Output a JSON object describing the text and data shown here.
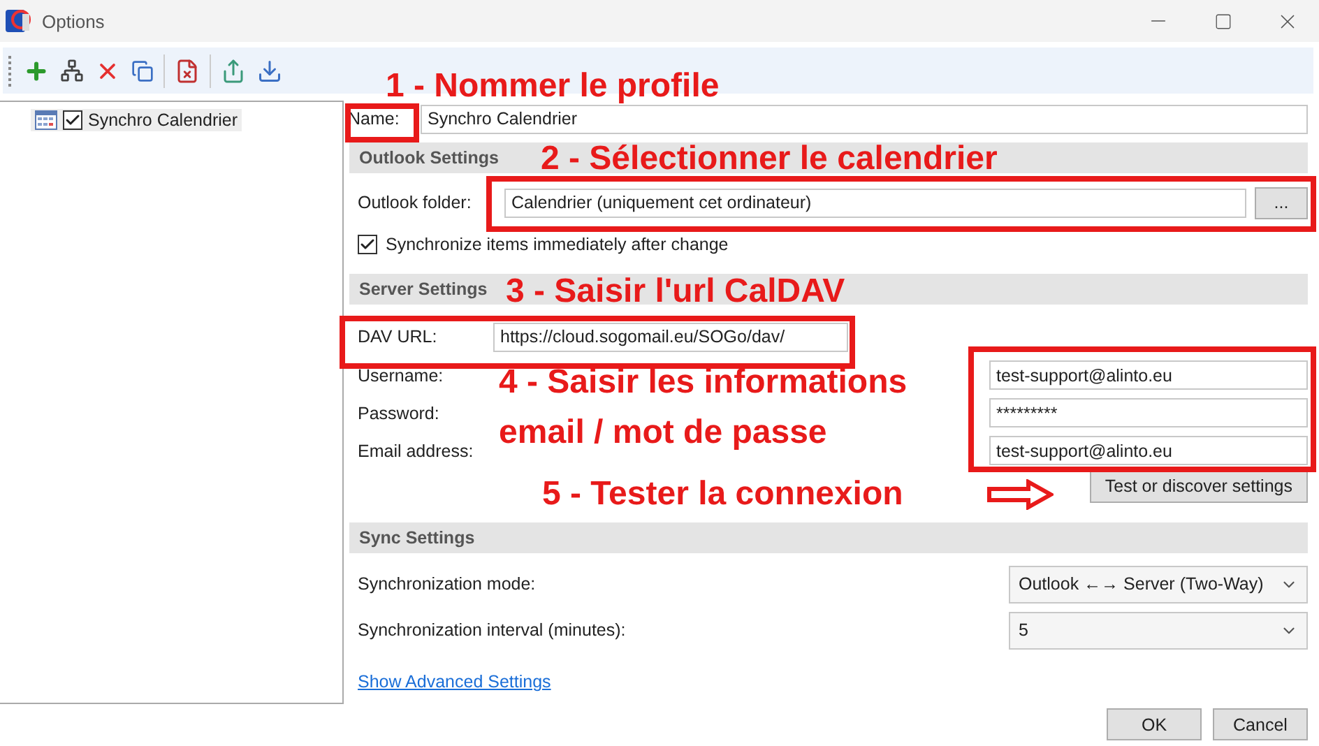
{
  "window": {
    "title": "Options"
  },
  "tree": {
    "items": [
      {
        "label": "Synchro Calendrier",
        "checked": true,
        "selected": true
      }
    ]
  },
  "profile": {
    "name_label": "Name:",
    "name_value": "Synchro Calendrier"
  },
  "outlook_settings": {
    "header": "Outlook Settings",
    "folder_label": "Outlook folder:",
    "folder_value": "Calendrier (uniquement cet ordinateur)",
    "browse_button": "...",
    "sync_immediately": {
      "label": "Synchronize items immediately after change",
      "checked": true
    }
  },
  "server_settings": {
    "header": "Server Settings",
    "dav_url_label": "DAV URL:",
    "dav_url": "https://cloud.sogomail.eu/SOGo/dav/",
    "fields": [
      {
        "label": "Username:",
        "value": "test-support@alinto.eu"
      },
      {
        "label": "Password:",
        "value": "*********"
      },
      {
        "label": "Email address:",
        "value": "test-support@alinto.eu"
      }
    ],
    "test_button": "Test or discover settings"
  },
  "sync_settings": {
    "header": "Sync Settings",
    "rows": [
      {
        "label": "Synchronization mode:",
        "value": "Outlook ←→ Server (Two-Way)"
      },
      {
        "label": "Synchronization interval (minutes):",
        "value": "5"
      }
    ]
  },
  "advanced_link": "Show Advanced Settings",
  "buttons": [
    "OK",
    "Cancel"
  ],
  "annotations": [
    {
      "text": "1 - Nommer le profile"
    },
    {
      "text": "2 - Sélectionner le calendrier"
    },
    {
      "text": "3 - Saisir l'url CalDAV"
    },
    {
      "text": "4 - Saisir les informations email / mot de passe"
    },
    {
      "text": "5 - Tester la connexion"
    }
  ]
}
